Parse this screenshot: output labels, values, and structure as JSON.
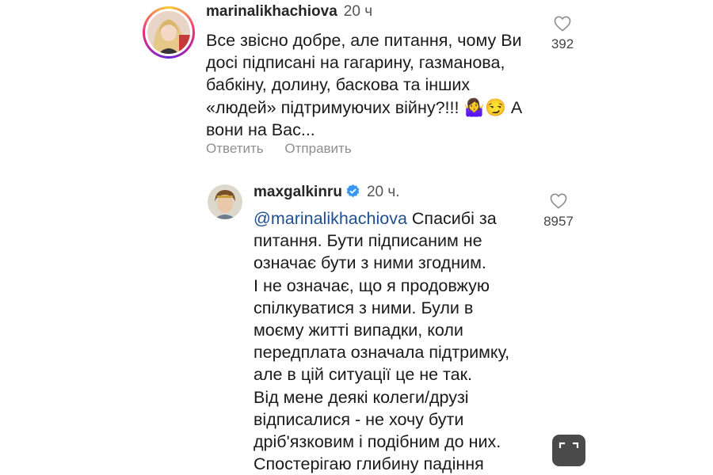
{
  "comments": [
    {
      "username": "marinalikhachiova",
      "time": "20 ч",
      "lines": [
        "Все звісно добре, але питання, чому Ви",
        "досі підписані на гагарину, газманова,",
        "бабкіну, долину, баскова та інших",
        "«людей» підтримуючих війну?!!! 🤷‍♀️😏 А",
        "вони на Вас..."
      ],
      "likes": "392",
      "actions": {
        "reply": "Ответить",
        "send": "Отправить"
      }
    },
    {
      "username": "maxgalkinru",
      "time": "20 ч.",
      "verified": true,
      "mention": "@marinalikhachiova",
      "first_line_rest": " Спасибі за",
      "lines": [
        "питання.  Бути підписаним не",
        "означає бути з ними згодним.",
        "І не означає, що я продовжую",
        "спілкуватися з ними.  Були в",
        "моєму житті випадки, коли",
        "передплата означала підтримку,",
        "але в цій ситуації це не так.",
        "Від мене деякі колеги/друзі",
        "відписалися - не хочу бути",
        "дріб'язковим і подібним до них.",
        "Спостерігаю глибину падіння"
      ],
      "likes": "8957"
    }
  ],
  "colors": {
    "verified": "#3897f0",
    "mention": "#1f4f8f"
  },
  "icons": {
    "like": "heart-outline-icon",
    "expand": "expand-icon"
  }
}
